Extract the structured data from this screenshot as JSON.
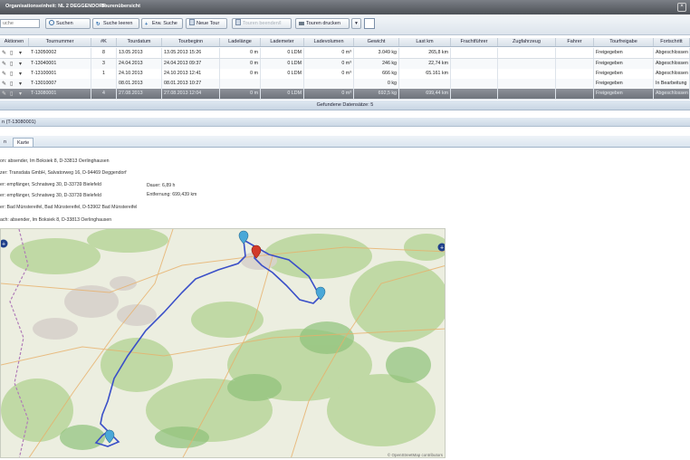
{
  "window": {
    "org_label": "Organisationseinheit: NL 2 DEGGENDORF",
    "title": "Tourenübersicht",
    "close_glyph": "×"
  },
  "toolbar": {
    "search_placeholder": "uche",
    "search_label": "Suchen",
    "reset_label": "Suche leeren",
    "extended_label": "Erw. Suche",
    "new_tour_label": "Neue Tour",
    "complete_label": "Touren beenden/l",
    "print_label": "Touren drucken",
    "dropdown_glyph": "▾"
  },
  "grid": {
    "columns": [
      "Aktionen",
      "Tournummer",
      "#K",
      "Tourdatum",
      "Tourbeginn",
      "Ladelänge",
      "Lademeter",
      "Ladevolumen",
      "Gewicht",
      "Last km",
      "Frachtführer",
      "Zugfahrzeug",
      "Fahrer",
      "Tourfreigabe",
      "Fortschritt"
    ],
    "rows": [
      {
        "nr": "T-13050002",
        "k": "8",
        "datum": "13.05.2013",
        "beginn": "13.05.2013 15:26",
        "laenge": "0 m",
        "meter": "0 LDM",
        "volumen": "0 m³",
        "gewicht": "3.049 kg",
        "km": "265,8 km",
        "freigabe": "Freigegeben",
        "fortschritt": "Abgeschlossen"
      },
      {
        "nr": "T-13040001",
        "k": "3",
        "datum": "24.04.2013",
        "beginn": "24.04.2013 09:37",
        "laenge": "0 m",
        "meter": "0 LDM",
        "volumen": "0 m³",
        "gewicht": "246 kg",
        "km": "22,74 km",
        "freigabe": "Freigegeben",
        "fortschritt": "Abgeschlossen"
      },
      {
        "nr": "T-13100001",
        "k": "1",
        "datum": "24.10.2013",
        "beginn": "24.10.2013 12:41",
        "laenge": "0 m",
        "meter": "0 LDM",
        "volumen": "0 m³",
        "gewicht": "666 kg",
        "km": "65.161 km",
        "freigabe": "Freigegeben",
        "fortschritt": "Abgeschlossen"
      },
      {
        "nr": "T-13010007",
        "k": "",
        "datum": "08.01.2013",
        "beginn": "08.01.2013 10:27",
        "laenge": "",
        "meter": "",
        "volumen": "",
        "gewicht": "0 kg",
        "km": "",
        "freigabe": "Freigegeben",
        "fortschritt": "In Bearbeitung"
      },
      {
        "nr": "T-13080001",
        "k": "4",
        "datum": "27.08.2013",
        "beginn": "27.08.2013 12:04",
        "laenge": "0 m",
        "meter": "0 LDM",
        "volumen": "0 m³",
        "gewicht": "692,5 kg",
        "km": "699,44 km",
        "freigabe": "Freigegeben",
        "fortschritt": "Abgeschlossen"
      }
    ],
    "footer": "Gefundene Datensätze: 5"
  },
  "detail": {
    "title": "n (T-13080001)",
    "tabs": [
      "n",
      "Karte"
    ],
    "lines": [
      "on: absender, Im Boksiek 8, D-33813 Oerlinghausen",
      "zer: Transdata GmbH, Salvatorweg 16, D-94469 Deggendorf",
      "er: empfänger, Schnatweg 30, D-33739 Bielefeld",
      "er: empfänger, Schnatweg 30, D-33739 Bielefeld",
      "er: Bad Münstereifel, Bad Münstereifel, D-53902 Bad Münstereifel",
      "ach: absender, Im Boksiek 8, D-33813 Oerlinghausen"
    ],
    "duration": "Dauer:         6,89 h",
    "distance": "Entfernung: 699,439 km"
  },
  "map": {
    "attribution": "© OpenStreetMap contributors",
    "route_color": "#3a4fc8",
    "marker_color": "#4aa8d8",
    "active_marker_color": "#d23a2a"
  }
}
